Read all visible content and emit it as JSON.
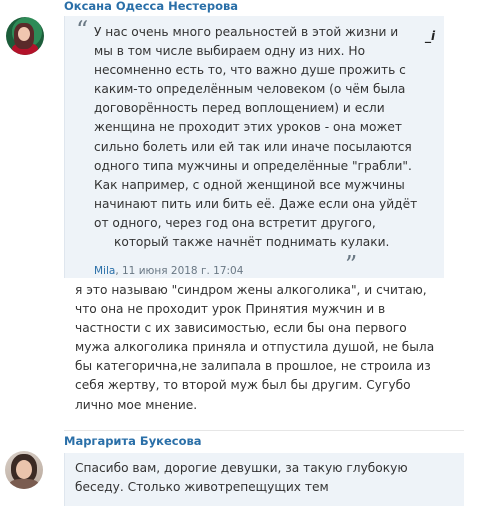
{
  "comments": [
    {
      "author": "Оксана Одесса Нестерова",
      "quote": {
        "lines": [
          "У нас очень много реальностей в этой жизни и",
          "мы в том числе выбираем одну из них. Но",
          "несомненно есть то, что важно душе прожить с",
          "каким-то определённым человеком (о чём была",
          "договорённость перед воплощением) и если",
          "женщина не проходит этих уроков - она может",
          "сильно болеть или ей так или иначе посылаются",
          "одного типа мужчины и определённые \"грабли\".",
          "Как например, с одной женщиной все мужчины",
          "начинают пить или бить её. Даже если она уйдёт",
          "от одного, через год она встретит другого,",
          "который также начнёт поднимать кулаки."
        ],
        "author": "Mila",
        "date": ", 11 июня 2018 г. 17:04",
        "open_mark": "“",
        "close_mark": "”",
        "icon_label": "_i"
      },
      "body_lines": [
        "я это называю \"синдром жены алкоголика\", и считаю,",
        "что она не проходит урок Принятия мужчин и в",
        "частности с их зависимостью, если бы она первого",
        "мужа алкоголика приняла и отпустила душой, не была",
        "бы категорична,не залипала в прошлое, не строила из",
        "себя жертву, то второй муж был бы другим. Сугубо",
        "лично мое мнение."
      ]
    },
    {
      "author": "Маргарита Букесова",
      "body_lines": [
        "Спасибо вам, дорогие девушки, за такую глубокую",
        "беседу. Столько животрепещущих тем"
      ]
    }
  ]
}
